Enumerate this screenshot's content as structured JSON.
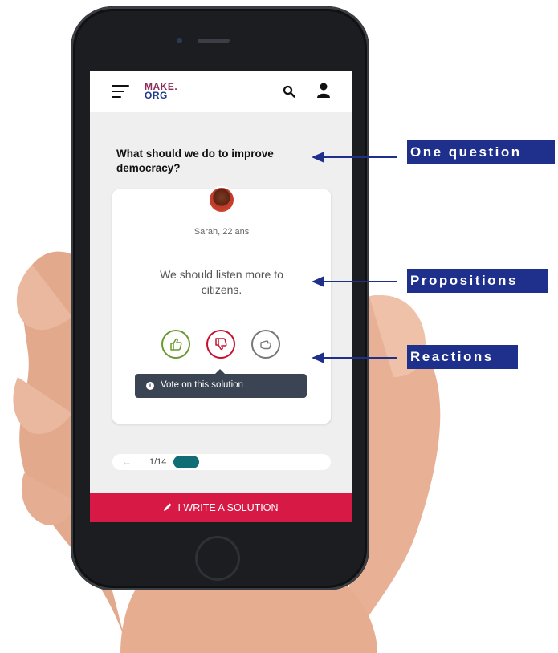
{
  "app": {
    "logo_line1": "MAKE.",
    "logo_line2": "ORG"
  },
  "header": {
    "menu_icon": "hamburger-menu-icon",
    "search_icon": "search-icon",
    "user_icon": "user-icon"
  },
  "question": "What should we do to improve democracy?",
  "proposal": {
    "author": "Sarah, 22 ans",
    "text": "We should listen more to citizens.",
    "votes": [
      {
        "name": "agree",
        "icon": "thumbs-up-icon",
        "color": "#6a9a2e"
      },
      {
        "name": "disagree",
        "icon": "thumbs-down-icon",
        "color": "#c8102e"
      },
      {
        "name": "neutral",
        "icon": "hand-neutral-icon",
        "color": "#777777"
      }
    ],
    "tooltip": "Vote on this solution"
  },
  "pager": {
    "counter": "1/14",
    "current": 1,
    "total": 14
  },
  "cta": {
    "label": "I WRITE A SOLUTION",
    "color": "#d71a45"
  },
  "annotations": {
    "question": "One question",
    "propositions": "Propositions",
    "reactions": "Reactions"
  },
  "colors": {
    "annotation": "#1f2f8c",
    "progress": "#0f6e75"
  }
}
